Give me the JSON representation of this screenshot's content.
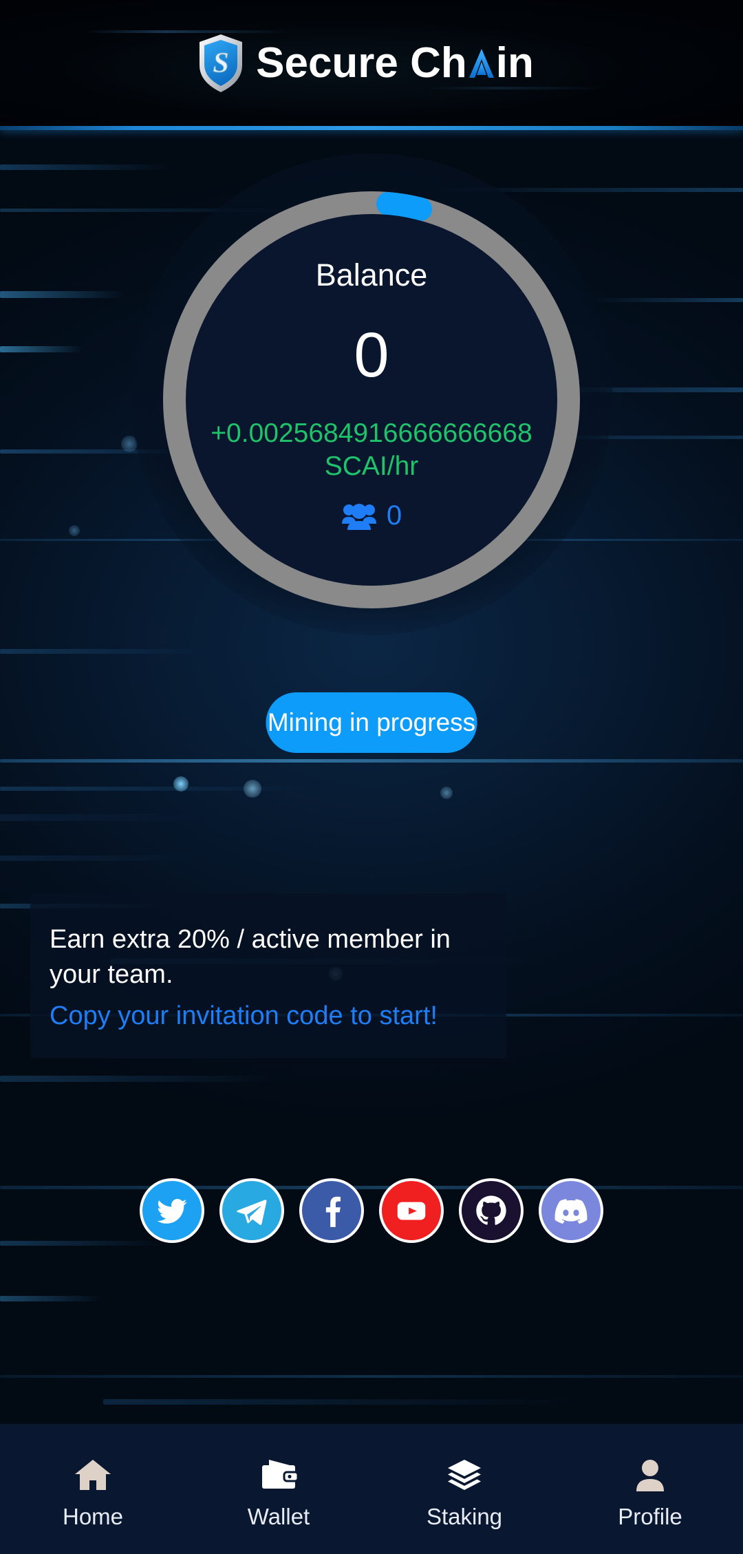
{
  "header": {
    "brand_part1": "Secure Ch",
    "brand_part2": "in",
    "logo_icon": "shield-s-logo-icon",
    "logo_letter": "S"
  },
  "balance_card": {
    "label": "Balance",
    "value": "0",
    "rate_amount": "+0.0025684916666666668",
    "rate_unit": "SCAI/hr",
    "team_icon": "people-group-icon",
    "team_count": "0",
    "ring_track_color": "#8a8a8a",
    "ring_progress_color": "#0d9cfa",
    "ring_progress_percent": 3,
    "inner_bg_color": "#0a152e",
    "rate_color": "#1fc36a",
    "team_color": "#1f7ef5"
  },
  "mining": {
    "button_label": "Mining in progress",
    "button_color": "#0d9cfa"
  },
  "invite": {
    "text": "Earn extra 20% / active member in your team.",
    "link": "Copy your invitation code to start!",
    "link_color": "#1f7ef5"
  },
  "socials": [
    {
      "name": "twitter",
      "icon": "twitter-bird-icon",
      "color": "#1da1f2"
    },
    {
      "name": "telegram",
      "icon": "telegram-paper-plane-icon",
      "color": "#29a9e1"
    },
    {
      "name": "facebook",
      "icon": "facebook-f-icon",
      "color": "#3b5ba9"
    },
    {
      "name": "youtube",
      "icon": "youtube-play-icon",
      "color": "#f02020"
    },
    {
      "name": "github",
      "icon": "github-cat-icon",
      "color": "#1a1030"
    },
    {
      "name": "discord",
      "icon": "discord-game-controller-face-icon",
      "color": "#7a87dc"
    }
  ],
  "bottom_nav": {
    "items": [
      {
        "label": "Home",
        "icon": "home-icon",
        "active": true,
        "icon_color": "#ded2c8"
      },
      {
        "label": "Wallet",
        "icon": "wallet-icon",
        "active": false,
        "icon_color": "#ffffff"
      },
      {
        "label": "Staking",
        "icon": "layers-icon",
        "active": false,
        "icon_color": "#ffffff"
      },
      {
        "label": "Profile",
        "icon": "person-icon",
        "active": false,
        "icon_color": "#ded2c8"
      }
    ]
  }
}
